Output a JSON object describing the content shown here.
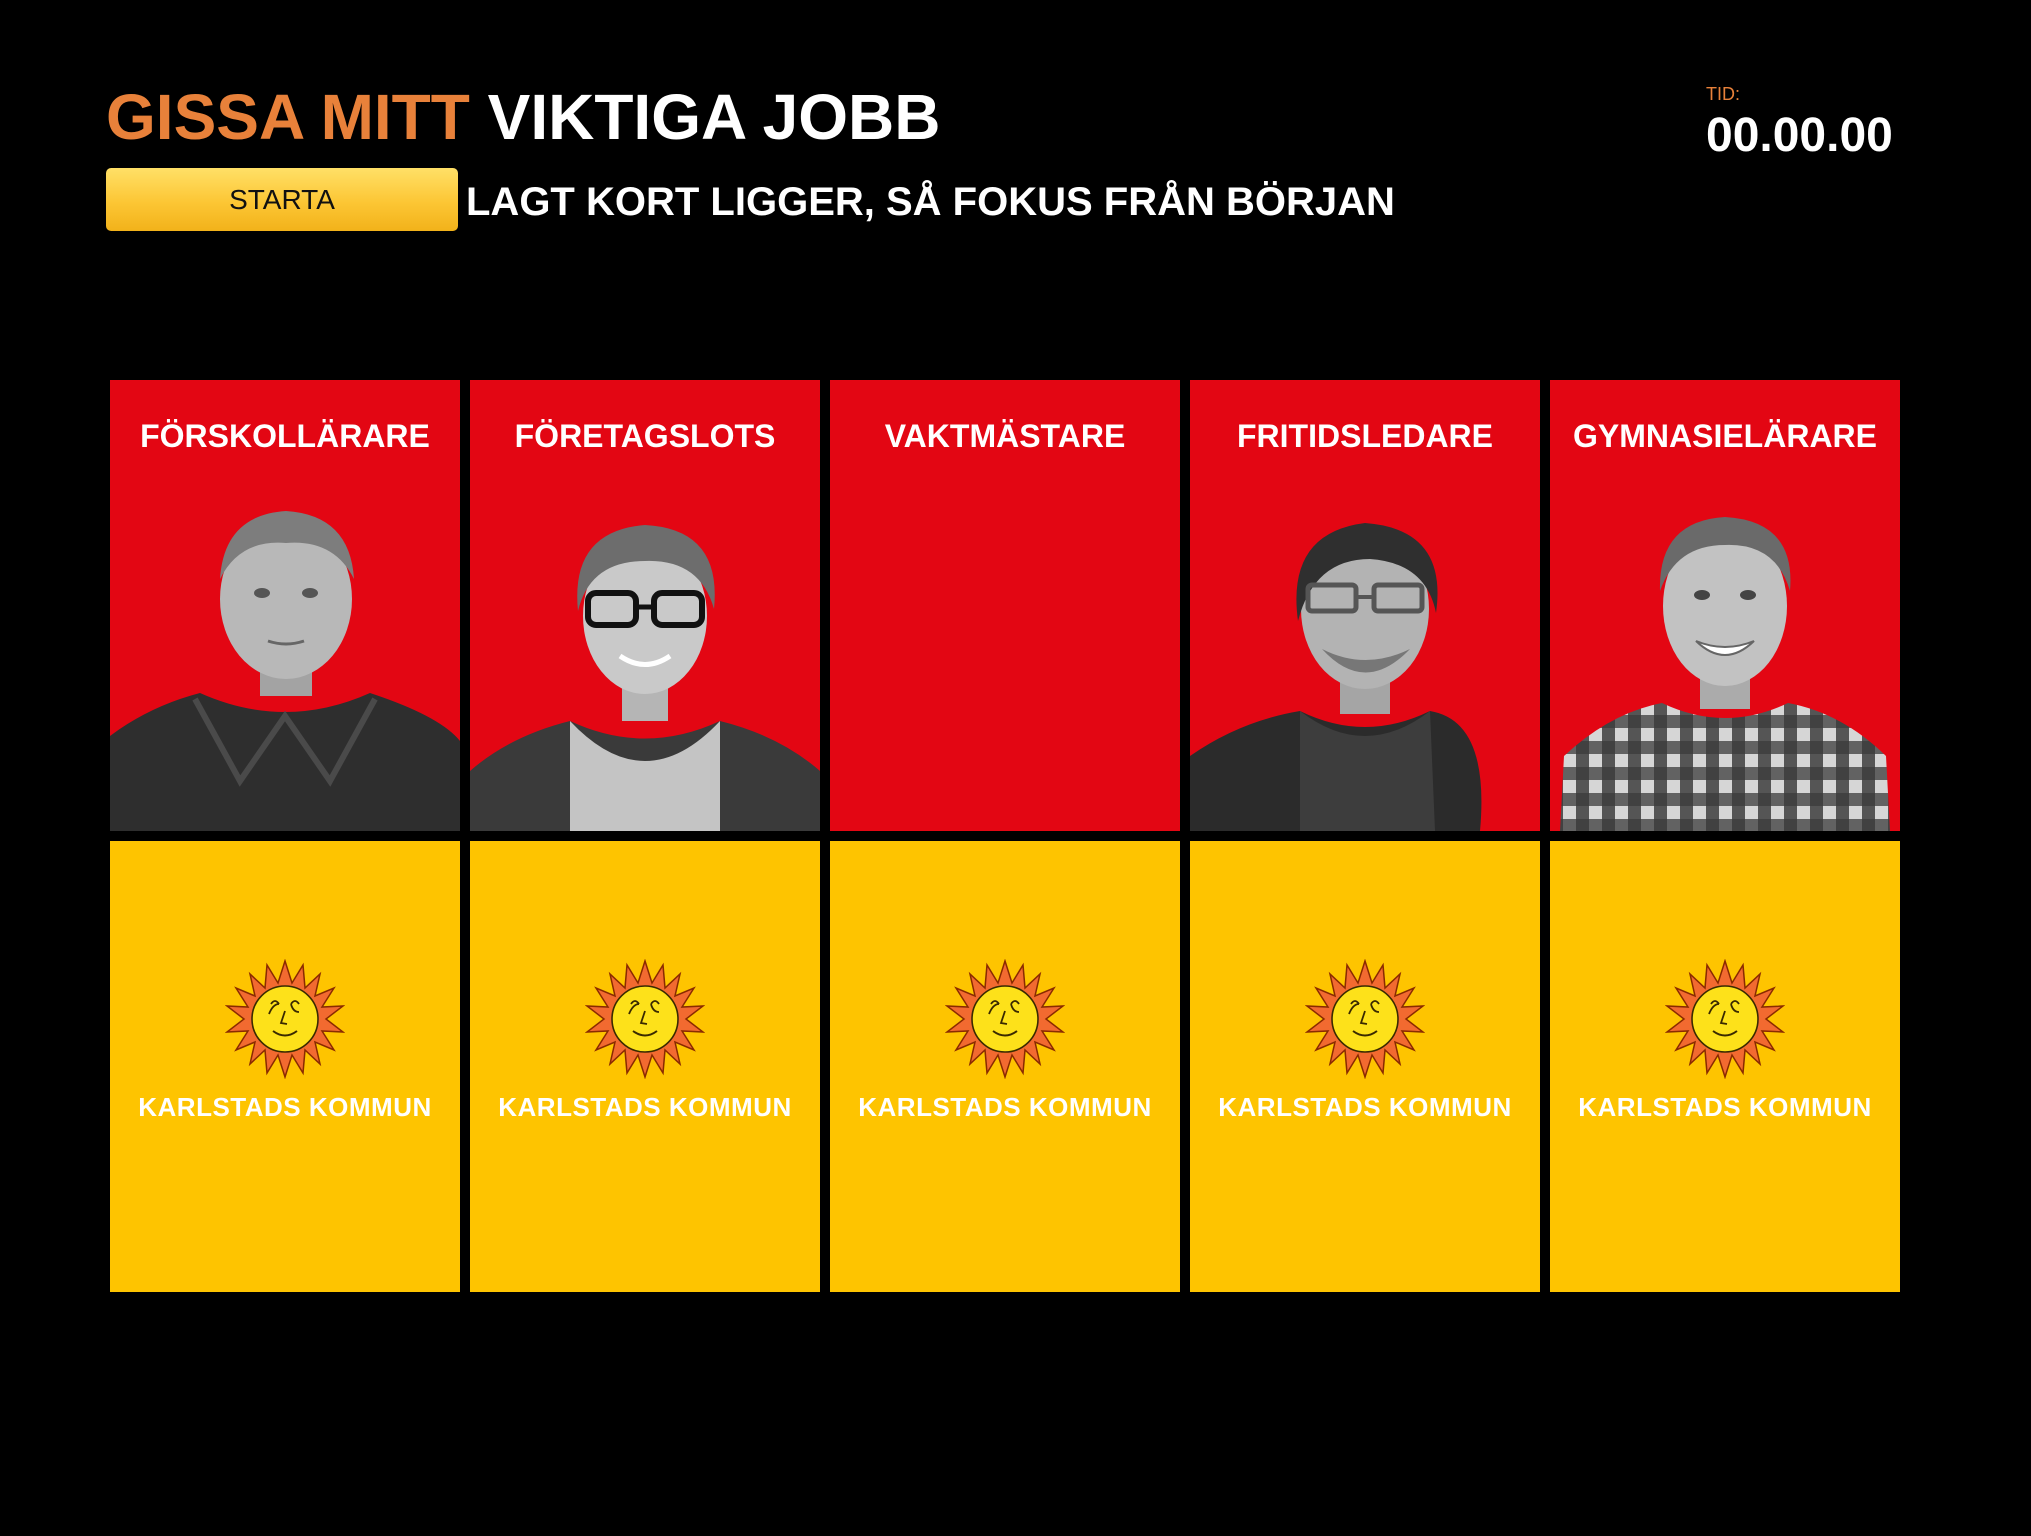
{
  "header": {
    "title_part1": "GISSA MITT",
    "title_part2": "VIKTIGA JOBB",
    "start_label": "STARTA",
    "subtitle": "LAGT KORT LIGGER, SÅ FOKUS FRÅN BÖRJAN"
  },
  "timer": {
    "label": "TID:",
    "value": "00.00.00"
  },
  "jobs": [
    {
      "title": "FÖRSKOLLÄRARE"
    },
    {
      "title": "FÖRETAGSLOTS"
    },
    {
      "title": "VAKTMÄSTARE"
    },
    {
      "title": "FRITIDSLEDARE"
    },
    {
      "title": "GYMNASIELÄRARE"
    }
  ],
  "card_back": {
    "logo_text": "KARLSTADS KOMMUN",
    "logo_icon": "sun-face-icon"
  },
  "colors": {
    "accent_orange": "#e8813a",
    "card_red": "#e30613",
    "card_yellow": "#fec400",
    "button_yellow": "#fcc634",
    "background": "#000000"
  }
}
